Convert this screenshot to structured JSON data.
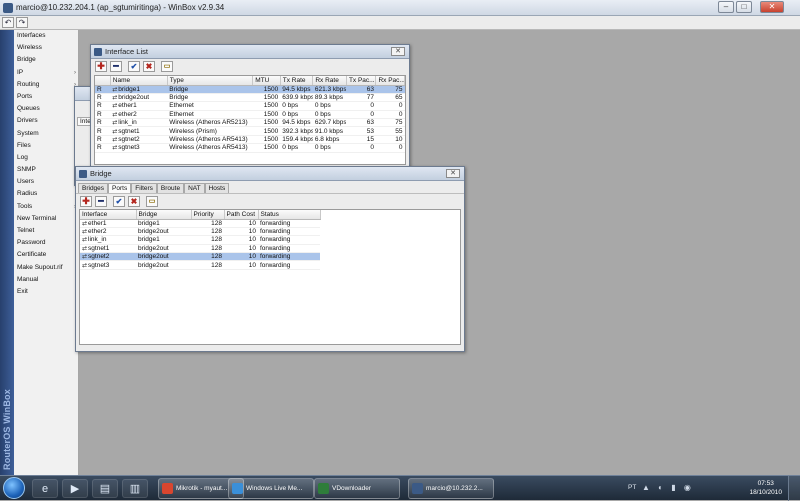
{
  "app": {
    "title": "marcio@10.232.204.1 (ap_sgtumiritinga) - WinBox v2.9.34",
    "brand": "RouterOS WinBox"
  },
  "toolbar": {
    "undo_icon": "undo-icon",
    "redo_icon": "redo-icon"
  },
  "sidebar": {
    "items": [
      {
        "label": "Interfaces",
        "submenu": false
      },
      {
        "label": "Wireless",
        "submenu": false
      },
      {
        "label": "Bridge",
        "submenu": false
      },
      {
        "label": "IP",
        "submenu": true
      },
      {
        "label": "Routing",
        "submenu": true
      },
      {
        "label": "Ports",
        "submenu": false
      },
      {
        "label": "Queues",
        "submenu": false
      },
      {
        "label": "Drivers",
        "submenu": false
      },
      {
        "label": "System",
        "submenu": true
      },
      {
        "label": "Files",
        "submenu": false
      },
      {
        "label": "Log",
        "submenu": false
      },
      {
        "label": "SNMP",
        "submenu": false
      },
      {
        "label": "Users",
        "submenu": false
      },
      {
        "label": "Radius",
        "submenu": false
      },
      {
        "label": "Tools",
        "submenu": true
      },
      {
        "label": "New Terminal",
        "submenu": false
      },
      {
        "label": "Telnet",
        "submenu": false
      },
      {
        "label": "Password",
        "submenu": false
      },
      {
        "label": "Certificate",
        "submenu": false
      },
      {
        "label": "Make Supout.rif",
        "submenu": false
      },
      {
        "label": "Manual",
        "submenu": false
      },
      {
        "label": "Exit",
        "submenu": false
      }
    ]
  },
  "background_window": {
    "tab_fragment": "Inte"
  },
  "interface_list": {
    "title": "Interface List",
    "columns": [
      "",
      "Name",
      "Type",
      "MTU",
      "Tx Rate",
      "Rx Rate",
      "Tx Pac...",
      "Rx Pac..."
    ],
    "rows": [
      {
        "flag": "R",
        "name": "bridge1",
        "type": "Bridge",
        "mtu": "1500",
        "tx": "94.5 kbps",
        "rx": "621.3 kbps",
        "txp": "63",
        "rxp": "75",
        "selected": true
      },
      {
        "flag": "R",
        "name": "bridge2out",
        "type": "Bridge",
        "mtu": "1500",
        "tx": "639.9 kbps",
        "rx": "89.3 kbps",
        "txp": "77",
        "rxp": "65",
        "selected": false
      },
      {
        "flag": "R",
        "name": "ether1",
        "type": "Ethernet",
        "mtu": "1500",
        "tx": "0 bps",
        "rx": "0 bps",
        "txp": "0",
        "rxp": "0",
        "selected": false
      },
      {
        "flag": "R",
        "name": "ether2",
        "type": "Ethernet",
        "mtu": "1500",
        "tx": "0 bps",
        "rx": "0 bps",
        "txp": "0",
        "rxp": "0",
        "selected": false
      },
      {
        "flag": "R",
        "name": "link_in",
        "type": "Wireless (Atheros AR5213)",
        "mtu": "1500",
        "tx": "94.5 kbps",
        "rx": "629.7 kbps",
        "txp": "63",
        "rxp": "75",
        "selected": false
      },
      {
        "flag": "R",
        "name": "sgtnet1",
        "type": "Wireless (Prism)",
        "mtu": "1500",
        "tx": "392.3 kbps",
        "rx": "91.0 kbps",
        "txp": "53",
        "rxp": "55",
        "selected": false
      },
      {
        "flag": "R",
        "name": "sgtnet2",
        "type": "Wireless (Atheros AR5413)",
        "mtu": "1500",
        "tx": "159.4 kbps",
        "rx": "6.8 kbps",
        "txp": "15",
        "rxp": "10",
        "selected": false
      },
      {
        "flag": "R",
        "name": "sgtnet3",
        "type": "Wireless (Atheros AR5413)",
        "mtu": "1500",
        "tx": "0 bps",
        "rx": "0 bps",
        "txp": "0",
        "rxp": "0",
        "selected": false
      }
    ]
  },
  "bridge": {
    "title": "Bridge",
    "tabs": [
      "Bridges",
      "Ports",
      "Filters",
      "Broute",
      "NAT",
      "Hosts"
    ],
    "active_tab": "Ports",
    "columns": [
      "Interface",
      "Bridge",
      "Priority",
      "Path Cost",
      "Status"
    ],
    "rows": [
      {
        "interface": "ether1",
        "bridge": "bridge1",
        "priority": "128",
        "cost": "10",
        "status": "forwarding",
        "selected": false
      },
      {
        "interface": "ether2",
        "bridge": "bridge2out",
        "priority": "128",
        "cost": "10",
        "status": "forwarding",
        "selected": false
      },
      {
        "interface": "link_in",
        "bridge": "bridge1",
        "priority": "128",
        "cost": "10",
        "status": "forwarding",
        "selected": false
      },
      {
        "interface": "sgtnet1",
        "bridge": "bridge2out",
        "priority": "128",
        "cost": "10",
        "status": "forwarding",
        "selected": false
      },
      {
        "interface": "sgtnet2",
        "bridge": "bridge2out",
        "priority": "128",
        "cost": "10",
        "status": "forwarding",
        "selected": true
      },
      {
        "interface": "sgtnet3",
        "bridge": "bridge2out",
        "priority": "128",
        "cost": "10",
        "status": "forwarding",
        "selected": false
      }
    ]
  },
  "taskbar": {
    "tasks": [
      {
        "label": "Mikrotik - myaut...",
        "color": "#d9462f"
      },
      {
        "label": "Windows Live Me...",
        "color": "#3a8fd9"
      },
      {
        "label": "VDownloader",
        "color": "#2e7d3a"
      },
      {
        "label": "marcio@10.232.2...",
        "color": "#3b5a86"
      }
    ],
    "language": "PT",
    "time": "07:53",
    "date": "18/10/2010"
  }
}
